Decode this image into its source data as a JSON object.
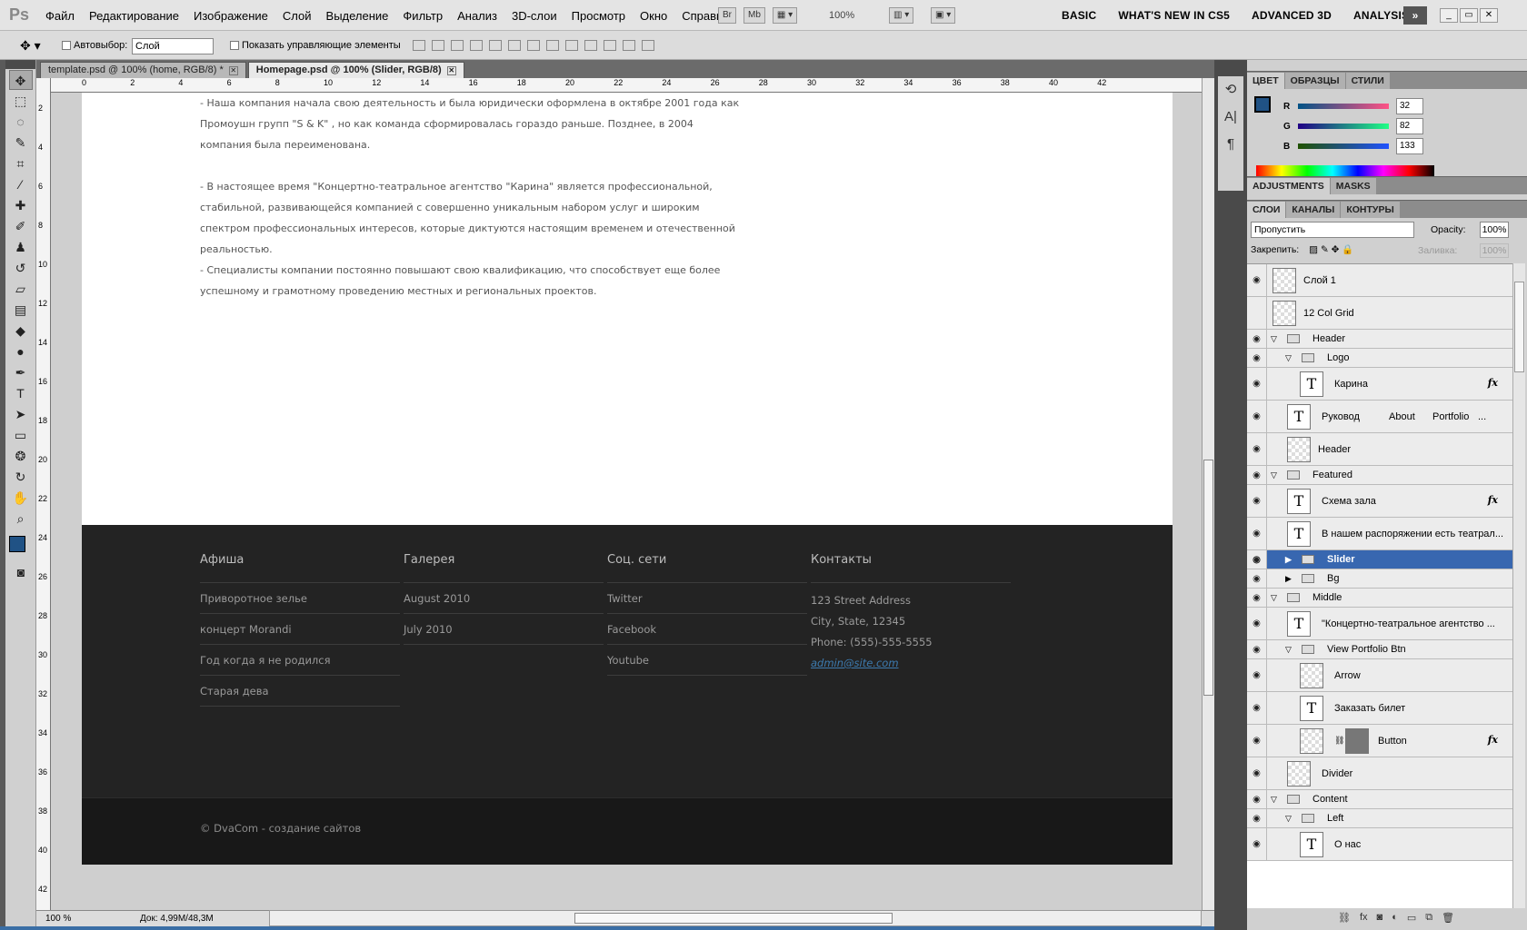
{
  "menubar": {
    "logo": "Ps",
    "menus": [
      "Файл",
      "Редактирование",
      "Изображение",
      "Слой",
      "Выделение",
      "Фильтр",
      "Анализ",
      "3D-слои",
      "Просмотр",
      "Окно",
      "Справка"
    ],
    "pills": [
      "Br",
      "Mb"
    ],
    "zoom": "100%",
    "workspaces": [
      "BASIC",
      "WHAT'S NEW IN CS5",
      "ADVANCED 3D",
      "ANALYSIS"
    ]
  },
  "options": {
    "autoselect_label": "Автовыбор:",
    "autoselect_value": "Слой",
    "show_controls_label": "Показать управляющие элементы"
  },
  "tabs": [
    {
      "label": "template.psd @ 100% (home, RGB/8) *"
    },
    {
      "label": "Homepage.psd @ 100% (Slider, RGB/8)"
    }
  ],
  "ruler": {
    "top": [
      "0",
      "2",
      "4",
      "6",
      "8",
      "10",
      "12",
      "14",
      "16",
      "18",
      "20",
      "22",
      "24",
      "26",
      "28",
      "30",
      "32",
      "34",
      "36",
      "38",
      "40",
      "42"
    ],
    "left": [
      "2",
      "4",
      "6",
      "8",
      "10",
      "12",
      "14",
      "16",
      "18",
      "20",
      "22",
      "24",
      "26",
      "28",
      "30",
      "32",
      "34",
      "36",
      "38",
      "40",
      "42"
    ]
  },
  "document": {
    "paragraphs": [
      "-   Наша компания начала свою деятельность и была юридически  оформлена в октябре 2001 года как Промоушн групп \"S & K\" , но как команда сформировалась гораздо раньше. Позднее, в  2004 компания была переименована.",
      "-  В настоящее время \"Концертно-театральное агентство \"Карина\" является профессиональной, стабильной, развивающейся  компанией с совершенно уникальным набором услуг и широким спектром профессиональных интересов, которые диктуются настоящим временем и отечественной реальностью.",
      "-  Специалисты компании постоянно повышают свою квалификацию, что способствует еще более успешному и грамотному проведению местных и региональных проектов."
    ],
    "footer": {
      "afisha": {
        "title": "Афиша",
        "items": [
          "Приворотное зелье",
          "концерт Morandi",
          "Год когда я не родился",
          "Старая дева"
        ]
      },
      "gallery": {
        "title": "Галерея",
        "items": [
          "August 2010",
          "July 2010"
        ]
      },
      "social": {
        "title": "Соц. сети",
        "items": [
          "Twitter",
          "Facebook",
          "Youtube"
        ]
      },
      "contacts": {
        "title": "Контакты",
        "lines": [
          "123 Street Address",
          "City, State, 12345",
          "Phone: (555)-555-5555"
        ],
        "email": "admin@site.com"
      }
    },
    "copyright": "©   DvaCom - создание сайтов"
  },
  "status": {
    "zoom": "100 %",
    "doc": "Док: 4,99M/48,3M"
  },
  "color_panel": {
    "tabs": [
      "ЦВЕТ",
      "ОБРАЗЦЫ",
      "СТИЛИ"
    ],
    "r_label": "R",
    "r": "32",
    "g_label": "G",
    "g": "82",
    "b_label": "B",
    "b": "133",
    "foreground": "#205285"
  },
  "adj_tabs": [
    "ADJUSTMENTS",
    "MASKS"
  ],
  "layers_panel": {
    "tabs": [
      "СЛОИ",
      "КАНАЛЫ",
      "КОНТУРЫ"
    ],
    "blend_mode": "Пропустить",
    "opacity_label": "Opacity:",
    "opacity": "100%",
    "lock_label": "Закрепить:",
    "fill_label": "Заливка:",
    "fill": "100%",
    "layers": [
      {
        "name": "Слой 1"
      },
      {
        "name": "12 Col Grid"
      },
      {
        "name": "Header"
      },
      {
        "name": "Logo"
      },
      {
        "name": "Карина"
      },
      {
        "name": "Руковод",
        "extra": "About",
        "extra2": "Portfolio",
        "extra3": "..."
      },
      {
        "name": "Header"
      },
      {
        "name": "Featured"
      },
      {
        "name": "Схема зала"
      },
      {
        "name": "В нашем распоряжении есть театрал..."
      },
      {
        "name": "Slider"
      },
      {
        "name": "Bg"
      },
      {
        "name": "Middle"
      },
      {
        "name": "\"Концертно-театральное агентство ..."
      },
      {
        "name": "View Portfolio Btn"
      },
      {
        "name": "Arrow"
      },
      {
        "name": "Заказать билет"
      },
      {
        "name": "Button"
      },
      {
        "name": "Divider"
      },
      {
        "name": "Content"
      },
      {
        "name": "Left"
      },
      {
        "name": "О нас"
      }
    ]
  }
}
